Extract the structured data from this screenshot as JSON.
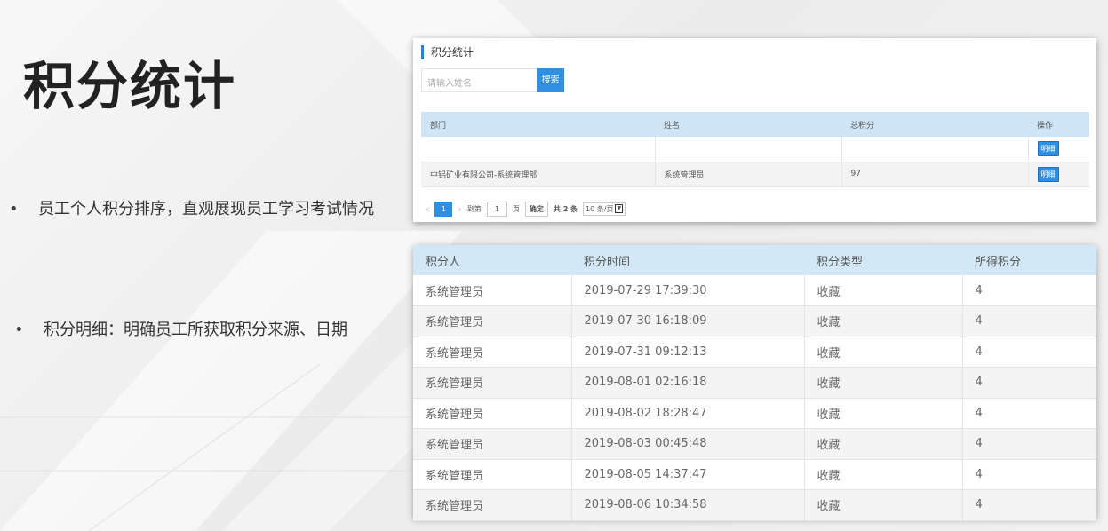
{
  "slide": {
    "title": "积分统计",
    "bullet_dot": "•",
    "bullets": [
      "员工个人积分排序，直观展现员工学习考试情况",
      "积分明细：明确员工所获取积分来源、日期"
    ]
  },
  "stats_panel": {
    "title": "积分统计",
    "search_placeholder": "请输入姓名",
    "search_button": "搜索",
    "headers": [
      "部门",
      "姓名",
      "总积分",
      "操作"
    ],
    "rows": [
      {
        "dept": "",
        "name": "",
        "total": "",
        "action": "明细"
      },
      {
        "dept": "中铝矿业有限公司-系统管理部",
        "name": "系统管理员",
        "total": "97",
        "action": "明细"
      }
    ],
    "pager": {
      "prev": "‹",
      "current_page": "1",
      "next": "›",
      "goto_label": "到第",
      "goto_value": "1",
      "page_unit": "页",
      "confirm": "确定",
      "total": "共 2 条",
      "page_size": "10 条/页"
    }
  },
  "detail_panel": {
    "headers": [
      "积分人",
      "积分时间",
      "积分类型",
      "所得积分"
    ],
    "rows": [
      {
        "person": "系统管理员",
        "time": "2019-07-29 17:39:30",
        "type": "收藏",
        "points": "4"
      },
      {
        "person": "系统管理员",
        "time": "2019-07-30 16:18:09",
        "type": "收藏",
        "points": "4"
      },
      {
        "person": "系统管理员",
        "time": "2019-07-31 09:12:13",
        "type": "收藏",
        "points": "4"
      },
      {
        "person": "系统管理员",
        "time": "2019-08-01 02:16:18",
        "type": "收藏",
        "points": "4"
      },
      {
        "person": "系统管理员",
        "time": "2019-08-02 18:28:47",
        "type": "收藏",
        "points": "4"
      },
      {
        "person": "系统管理员",
        "time": "2019-08-03 00:45:48",
        "type": "收藏",
        "points": "4"
      },
      {
        "person": "系统管理员",
        "time": "2019-08-05 14:37:47",
        "type": "收藏",
        "points": "4"
      },
      {
        "person": "系统管理员",
        "time": "2019-08-06 10:34:58",
        "type": "收藏",
        "points": "4"
      }
    ]
  },
  "colors": {
    "accent": "#2f8fe0",
    "header_bg": "#d3e8f6"
  }
}
